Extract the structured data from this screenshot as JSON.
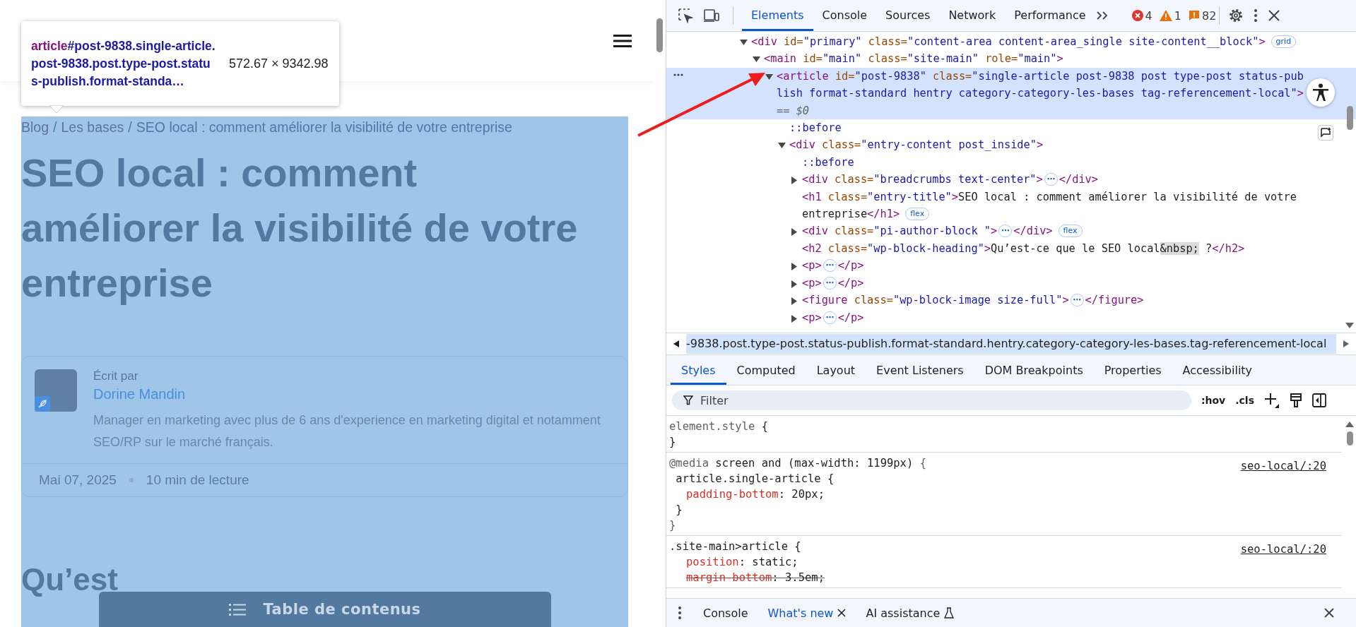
{
  "page": {
    "tooltip": {
      "tag": "article",
      "selector": "#post-9838.single-article.post-9838.post.type-post.status-publish.format-standa…",
      "size": "572.67 × 9342.98"
    },
    "breadcrumb": [
      {
        "kind": "link",
        "text": "Blog"
      },
      {
        "kind": "separator",
        "text": "/"
      },
      {
        "kind": "link",
        "text": "Les bases"
      },
      {
        "kind": "separator",
        "text": "/"
      },
      {
        "kind": "current",
        "text": "SEO local : comment améliorer la visibilité de votre entreprise"
      }
    ],
    "title": "SEO local : comment améliorer la visibilité de votre entreprise",
    "author": {
      "label": "Écrit par",
      "name": "Dorine Mandin",
      "bio": "Manager en marketing avec plus de 6 ans d'experience en marketing digital et notamment SEO/RP sur le marché français.",
      "date": "Mai 07, 2025",
      "reading_time": "10 min de lecture"
    },
    "heading_visible": "Qu’est",
    "toc_button": "Table de contenus"
  },
  "devtools": {
    "tabs": [
      {
        "label": "Elements",
        "selected": true
      },
      {
        "label": "Console",
        "selected": false
      },
      {
        "label": "Sources",
        "selected": false
      },
      {
        "label": "Network",
        "selected": false
      },
      {
        "label": "Performance",
        "selected": false
      }
    ],
    "counters": [
      {
        "kind": "error",
        "count": "4"
      },
      {
        "kind": "warning",
        "count": "1"
      },
      {
        "kind": "issue",
        "count": "82"
      }
    ],
    "dom_tree": [
      {
        "kind": "parent",
        "expanded": true,
        "selected": false,
        "tokens": [
          {
            "kind": "tag",
            "text": "<div"
          },
          {
            "kind": "attr",
            "text": " id="
          },
          {
            "kind": "value",
            "text": "\"primary\""
          },
          {
            "kind": "attr",
            "text": " class="
          },
          {
            "kind": "value",
            "text": "\"content-area content-area_single site-content__block\""
          },
          {
            "kind": "tag",
            "text": ">"
          },
          {
            "kind": "badge",
            "text": "grid"
          }
        ],
        "children": [
          {
            "kind": "parent",
            "expanded": true,
            "selected": false,
            "tokens": [
              {
                "kind": "tag",
                "text": "<main"
              },
              {
                "kind": "attr",
                "text": " id="
              },
              {
                "kind": "value",
                "text": "\"main\""
              },
              {
                "kind": "attr",
                "text": " class="
              },
              {
                "kind": "value",
                "text": "\"site-main\""
              },
              {
                "kind": "attr",
                "text": " role="
              },
              {
                "kind": "value",
                "text": "\"main\""
              },
              {
                "kind": "tag",
                "text": ">"
              }
            ],
            "children": [
              {
                "kind": "parent",
                "expanded": true,
                "selected": true,
                "tokens": [
                  {
                    "kind": "tag",
                    "text": "<article"
                  },
                  {
                    "kind": "attr",
                    "text": " id="
                  },
                  {
                    "kind": "value",
                    "text": "\"post-9838\""
                  },
                  {
                    "kind": "attr",
                    "text": " class="
                  },
                  {
                    "kind": "value",
                    "text": "\"single-article post-9838 post type-post status-publish format-standard hentry category-category-les-bases tag-referencement-local\""
                  },
                  {
                    "kind": "tag",
                    "text": ">"
                  },
                  {
                    "kind": "dim",
                    "text": " == $0"
                  }
                ],
                "children": [
                  {
                    "kind": "leaf",
                    "selected": false,
                    "tokens": [
                      {
                        "kind": "pseudo",
                        "text": "::before"
                      }
                    ]
                  },
                  {
                    "kind": "parent",
                    "expanded": true,
                    "selected": false,
                    "tokens": [
                      {
                        "kind": "tag",
                        "text": "<div"
                      },
                      {
                        "kind": "attr",
                        "text": " class="
                      },
                      {
                        "kind": "value",
                        "text": "\"entry-content post_inside\""
                      },
                      {
                        "kind": "tag",
                        "text": ">"
                      }
                    ],
                    "children": [
                      {
                        "kind": "leaf",
                        "selected": false,
                        "tokens": [
                          {
                            "kind": "pseudo",
                            "text": "::before"
                          }
                        ]
                      },
                      {
                        "kind": "parent",
                        "expanded": false,
                        "selected": false,
                        "tokens": [
                          {
                            "kind": "tag",
                            "text": "<div"
                          },
                          {
                            "kind": "attr",
                            "text": " class="
                          },
                          {
                            "kind": "value",
                            "text": "\"breadcrumbs text-center\""
                          },
                          {
                            "kind": "tag",
                            "text": ">"
                          },
                          {
                            "kind": "ellipsis",
                            "text": "⋯"
                          },
                          {
                            "kind": "tag",
                            "text": "</div>"
                          }
                        ]
                      },
                      {
                        "kind": "leaf",
                        "selected": false,
                        "tokens": [
                          {
                            "kind": "tag",
                            "text": "<h1"
                          },
                          {
                            "kind": "attr",
                            "text": " class="
                          },
                          {
                            "kind": "value",
                            "text": "\"entry-title\""
                          },
                          {
                            "kind": "tag",
                            "text": ">"
                          },
                          {
                            "kind": "text",
                            "text": "SEO local : comment améliorer la visibilité de votre entreprise"
                          },
                          {
                            "kind": "tag",
                            "text": "</h1>"
                          },
                          {
                            "kind": "badge",
                            "text": "flex"
                          }
                        ]
                      },
                      {
                        "kind": "parent",
                        "expanded": false,
                        "selected": false,
                        "tokens": [
                          {
                            "kind": "tag",
                            "text": "<div"
                          },
                          {
                            "kind": "attr",
                            "text": " class="
                          },
                          {
                            "kind": "value",
                            "text": "\"pi-author-block \""
                          },
                          {
                            "kind": "tag",
                            "text": ">"
                          },
                          {
                            "kind": "ellipsis",
                            "text": "⋯"
                          },
                          {
                            "kind": "tag",
                            "text": "</div>"
                          },
                          {
                            "kind": "badge",
                            "text": "flex"
                          }
                        ]
                      },
                      {
                        "kind": "leaf",
                        "selected": false,
                        "tokens": [
                          {
                            "kind": "tag",
                            "text": "<h2"
                          },
                          {
                            "kind": "attr",
                            "text": " class="
                          },
                          {
                            "kind": "value",
                            "text": "\"wp-block-heading\""
                          },
                          {
                            "kind": "tag",
                            "text": ">"
                          },
                          {
                            "kind": "text",
                            "text": "Qu’est-ce que le SEO local"
                          },
                          {
                            "kind": "entity",
                            "text": "&nbsp;"
                          },
                          {
                            "kind": "text",
                            "text": " ?"
                          },
                          {
                            "kind": "tag",
                            "text": "</h2>"
                          }
                        ]
                      },
                      {
                        "kind": "parent",
                        "expanded": false,
                        "selected": false,
                        "tokens": [
                          {
                            "kind": "tag",
                            "text": "<p>"
                          },
                          {
                            "kind": "ellipsis",
                            "text": "⋯"
                          },
                          {
                            "kind": "tag",
                            "text": "</p>"
                          }
                        ]
                      },
                      {
                        "kind": "parent",
                        "expanded": false,
                        "selected": false,
                        "tokens": [
                          {
                            "kind": "tag",
                            "text": "<p>"
                          },
                          {
                            "kind": "ellipsis",
                            "text": "⋯"
                          },
                          {
                            "kind": "tag",
                            "text": "</p>"
                          }
                        ]
                      },
                      {
                        "kind": "parent",
                        "expanded": false,
                        "selected": false,
                        "tokens": [
                          {
                            "kind": "tag",
                            "text": "<figure"
                          },
                          {
                            "kind": "attr",
                            "text": " class="
                          },
                          {
                            "kind": "value",
                            "text": "\"wp-block-image size-full\""
                          },
                          {
                            "kind": "tag",
                            "text": ">"
                          },
                          {
                            "kind": "ellipsis",
                            "text": "⋯"
                          },
                          {
                            "kind": "tag",
                            "text": "</figure>"
                          }
                        ]
                      },
                      {
                        "kind": "parent",
                        "expanded": false,
                        "selected": false,
                        "tokens": [
                          {
                            "kind": "tag",
                            "text": "<p>"
                          },
                          {
                            "kind": "ellipsis",
                            "text": "⋯"
                          },
                          {
                            "kind": "tag",
                            "text": "</p>"
                          }
                        ]
                      }
                    ]
                  }
                ]
              }
            ]
          }
        ]
      }
    ],
    "node_path": "-9838.post.type-post.status-publish.format-standard.hentry.category-category-les-bases.tag-referencement-local",
    "panel_tabs": [
      {
        "label": "Styles",
        "selected": true
      },
      {
        "label": "Computed",
        "selected": false
      },
      {
        "label": "Layout",
        "selected": false
      },
      {
        "label": "Event Listeners",
        "selected": false
      },
      {
        "label": "DOM Breakpoints",
        "selected": false
      },
      {
        "label": "Properties",
        "selected": false
      },
      {
        "label": "Accessibility",
        "selected": false
      }
    ],
    "filter": {
      "placeholder": "Filter"
    },
    "filter_tools": [
      ":hov",
      ".cls"
    ],
    "style_rules": [
      {
        "lines": [
          {
            "kind": "code",
            "tokens": [
              {
                "kind": "dim",
                "text": "element.style"
              },
              {
                "kind": "plain",
                "text": " {"
              }
            ]
          },
          {
            "kind": "code",
            "tokens": [
              {
                "kind": "plain",
                "text": "}"
              }
            ]
          }
        ]
      },
      {
        "source": "seo-local/:20",
        "lines": [
          {
            "kind": "code",
            "tokens": [
              {
                "kind": "at",
                "text": "@media"
              },
              {
                "kind": "plain",
                "text": " screen and (max-width: 1199px) "
              },
              {
                "kind": "at",
                "text": "{"
              }
            ]
          },
          {
            "kind": "code",
            "tokens": [
              {
                "kind": "plain",
                "text": " article.single-article {"
              }
            ]
          },
          {
            "kind": "declaration",
            "overridden": false,
            "tokens": [
              {
                "kind": "prop",
                "text": "padding-bottom"
              },
              {
                "kind": "plain",
                "text": ": 20px;"
              }
            ]
          },
          {
            "kind": "code",
            "tokens": [
              {
                "kind": "plain",
                "text": " }"
              }
            ]
          },
          {
            "kind": "code",
            "tokens": [
              {
                "kind": "at",
                "text": "}"
              }
            ]
          }
        ]
      },
      {
        "source": "seo-local/:20",
        "lines": [
          {
            "kind": "code",
            "tokens": [
              {
                "kind": "plain",
                "text": ".site-main>article {"
              }
            ]
          },
          {
            "kind": "declaration",
            "overridden": false,
            "tokens": [
              {
                "kind": "prop",
                "text": "position"
              },
              {
                "kind": "plain",
                "text": ": static;"
              }
            ]
          },
          {
            "kind": "declaration",
            "overridden": true,
            "tokens": [
              {
                "kind": "prop",
                "text": "margin-bottom"
              },
              {
                "kind": "plain",
                "text": ": 3.5em;"
              }
            ]
          }
        ]
      }
    ],
    "drawer_tabs": [
      {
        "label": "Console",
        "selected": false,
        "closable": false,
        "kind": "plain"
      },
      {
        "label": "What's new",
        "selected": true,
        "closable": true,
        "kind": "plain"
      },
      {
        "label": "AI assistance",
        "selected": false,
        "closable": false,
        "kind": "lab"
      }
    ]
  }
}
